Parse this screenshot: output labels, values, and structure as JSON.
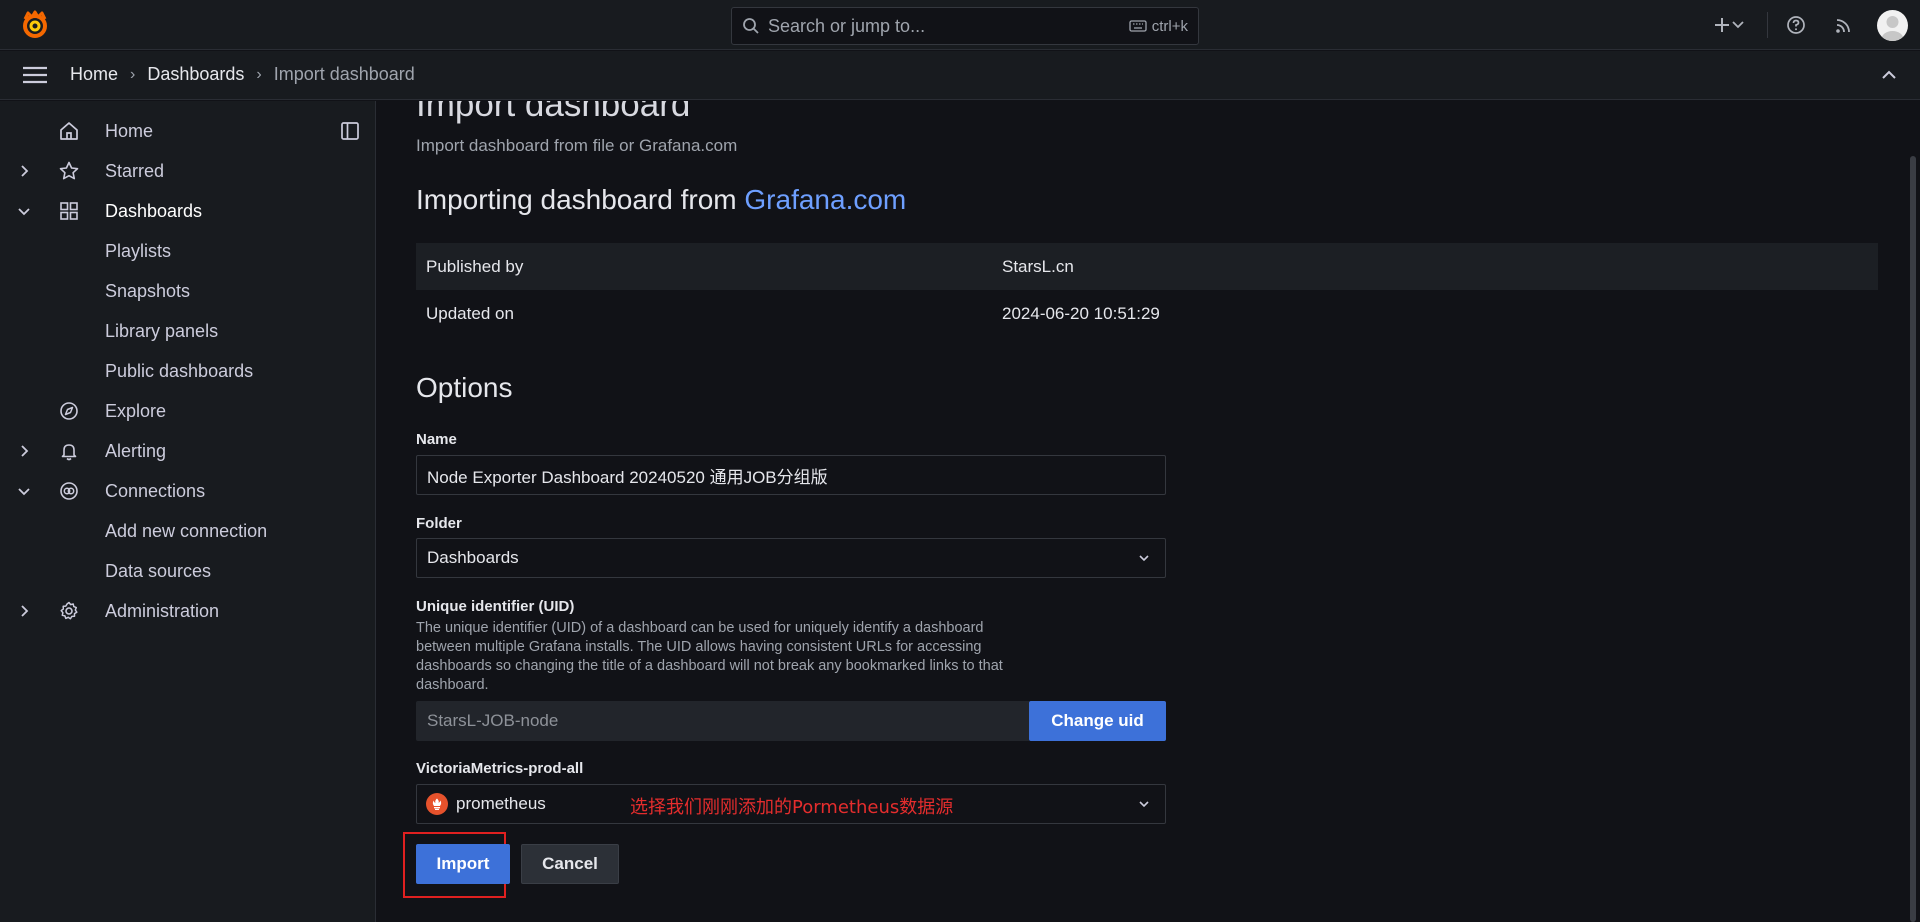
{
  "topbar": {
    "search_placeholder": "Search or jump to...",
    "search_shortcut": "ctrl+k",
    "icons": [
      "grafana-logo",
      "search-icon",
      "keyboard-icon",
      "plus-icon",
      "chevron-down-icon",
      "help-icon",
      "rss-icon",
      "avatar"
    ]
  },
  "breadcrumb": {
    "items": [
      "Home",
      "Dashboards",
      "Import dashboard"
    ],
    "separator": "›"
  },
  "sidebar": {
    "items": [
      {
        "label": "Home",
        "icon": "home-icon",
        "expandable": false
      },
      {
        "label": "Starred",
        "icon": "star-icon",
        "expandable": true,
        "expanded": false
      },
      {
        "label": "Dashboards",
        "icon": "apps-icon",
        "expandable": true,
        "expanded": true,
        "active": true
      },
      {
        "label": "Playlists",
        "child": true
      },
      {
        "label": "Snapshots",
        "child": true
      },
      {
        "label": "Library panels",
        "child": true
      },
      {
        "label": "Public dashboards",
        "child": true
      },
      {
        "label": "Explore",
        "icon": "compass-icon",
        "expandable": false
      },
      {
        "label": "Alerting",
        "icon": "bell-icon",
        "expandable": true,
        "expanded": false
      },
      {
        "label": "Connections",
        "icon": "link-icon",
        "expandable": true,
        "expanded": true
      },
      {
        "label": "Add new connection",
        "child": true
      },
      {
        "label": "Data sources",
        "child": true
      },
      {
        "label": "Administration",
        "icon": "cog-icon",
        "expandable": true,
        "expanded": false
      }
    ]
  },
  "main": {
    "title": "Import dashboard",
    "subtitle": "Import dashboard from file or Grafana.com",
    "importing_prefix": "Importing dashboard from ",
    "importing_link": "Grafana.com",
    "info": [
      {
        "key": "Published by",
        "value": "StarsL.cn"
      },
      {
        "key": "Updated on",
        "value": "2024-06-20 10:51:29"
      }
    ],
    "options_title": "Options",
    "name_label": "Name",
    "name_value": "Node Exporter Dashboard 20240520 通用JOB分组版",
    "folder_label": "Folder",
    "folder_value": "Dashboards",
    "uid_label": "Unique identifier (UID)",
    "uid_description": "The unique identifier (UID) of a dashboard can be used for uniquely identify a dashboard between multiple Grafana installs. The UID allows having consistent URLs for accessing dashboards so changing the title of a dashboard will not break any bookmarked links to that dashboard.",
    "uid_value": "StarsL-JOB-node",
    "change_uid_button": "Change uid",
    "datasource_label": "VictoriaMetrics-prod-all",
    "datasource_value": "prometheus",
    "datasource_annotation": "选择我们刚刚添加的Pormetheus数据源",
    "import_button": "Import",
    "cancel_button": "Cancel"
  },
  "colors": {
    "background": "#111217",
    "panel": "#181b1f",
    "primary": "#3d71d9",
    "link": "#6e9fff",
    "annotation": "#e52d2d",
    "grafana_orange": "#f46800",
    "prometheus": "#e6522c"
  }
}
